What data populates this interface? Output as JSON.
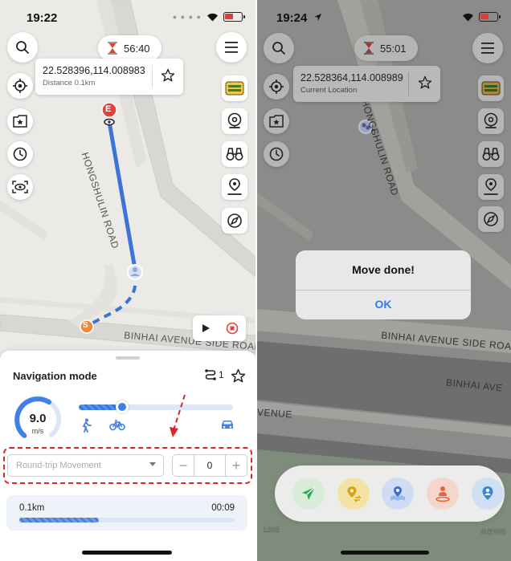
{
  "colors": {
    "accent": "#3f7fe6",
    "route": "#3b73d6",
    "start_marker": "#f0883e",
    "end_marker": "#e0433b",
    "dialog_ok": "#2f7bf0",
    "annotation": "#d92525"
  },
  "left_screen": {
    "status_time": "19:22",
    "timer": "56:40",
    "coord_card": {
      "coordinates": "22.528396,114.008983",
      "subtitle": "Distance 0.1km"
    },
    "road_labels": {
      "vertical": "HONGSHULIN ROAD",
      "horizontal": "BINHAI AVENUE SIDE ROAD"
    },
    "markers": {
      "start": "S",
      "end": "E"
    },
    "left_buttons": [
      "crosshair-icon",
      "star-folder-icon",
      "history-clock-icon",
      "eye-scan-icon"
    ],
    "right_buttons": [
      "game-logo-icon",
      "joystick-icon",
      "binoculars-icon",
      "location-pin-route-icon",
      "compass-icon"
    ],
    "panel": {
      "title": "Navigation mode",
      "route_count": "1",
      "speed_value": "9.0",
      "speed_unit": "m/s",
      "speed_level": 0.28,
      "transport_modes": [
        "walk-icon",
        "bike-icon",
        "car-icon"
      ],
      "movement_select_placeholder": "Round-trip Movement",
      "stepper_minus": "−",
      "stepper_value": "0",
      "stepper_plus": "+",
      "progress_distance": "0.1km",
      "progress_time": "00:09",
      "progress_fraction": 0.37
    }
  },
  "right_screen": {
    "status_time": "19:24",
    "timer": "55:01",
    "coord_card": {
      "coordinates": "22.528364,114.008989",
      "subtitle": "Current Location"
    },
    "road_labels": {
      "vertical": "HONGSHULIN ROAD",
      "horizontal": "BINHAI AVENUE SIDE ROAD",
      "horizontal2": "BINHAI AVE",
      "horizontal3": "VENUE"
    },
    "dialog": {
      "title": "Move done!",
      "ok": "OK"
    },
    "dock": [
      "send-icon",
      "location-exchange-icon",
      "map-pin-icon",
      "person-pin-icon",
      "user-location-icon"
    ],
    "legal": "Legal",
    "map_provider": "高德地图"
  }
}
